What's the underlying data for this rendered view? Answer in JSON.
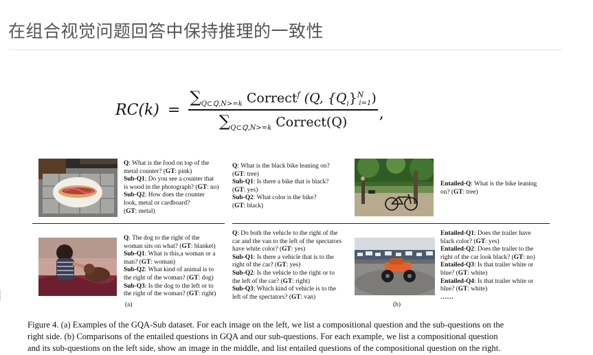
{
  "slide": {
    "title": "在组合视觉问题回答中保持推理的一致性"
  },
  "formula": {
    "lhs": "RC(k)",
    "equals": "=",
    "numerator": "Correct",
    "numerator_sup": "f",
    "denominator": "Correct(Q)",
    "sum_subscript": "Q⊂ℚ,N>=k",
    "args": "(Q, {Q",
    "args_sub": "i",
    "args_close": "}",
    "args_sup": "N",
    "args_sub2": "i=1",
    "args_end": ")",
    "trailing": ","
  },
  "figure": {
    "panel_a": {
      "q1": {
        "lines": [
          [
            "Q",
            ": What is the food on top of the"
          ],
          [
            "",
            "metal counter? ("
          ],
          [
            "Sub-Q1",
            ": Do you see a counter that"
          ],
          [
            "",
            "is wood in the photograph? ("
          ],
          [
            "Sub-Q2",
            ": How does the counter"
          ],
          [
            "",
            "look, metal or cardboard?"
          ],
          [
            "",
            "("
          ]
        ],
        "gt1": "GT",
        "gt1_val": ": pink)",
        "gt2": "GT",
        "gt2_val": ": no)",
        "gt3": "GT",
        "gt3_val": ": metal)"
      },
      "q2": {
        "l1a": "Q",
        "l1b": ": The dog to the right of the",
        "l2a": "woman sits on what? (",
        "l2gt": "GT",
        "l2b": ": blanket)",
        "l3a": "Sub-Q1",
        "l3b": ": What is this,a woman or a",
        "l4a": "man? (",
        "l4gt": "GT",
        "l4b": ": woman)",
        "l5a": "Sub-Q2",
        "l5b": ": What kind of animal is to",
        "l6a": "the right of the woman? (",
        "l6gt": "GT",
        "l6b": ": dog)",
        "l7a": "Sub-Q3",
        "l7b": ": Is the dog to the left or to",
        "l8a": "the right of the woman? (",
        "l8gt": "GT",
        "l8b": ": right)"
      },
      "label": "(a)"
    },
    "panel_b": {
      "top_left": {
        "l1a": "Q",
        "l1b": ": What is the black bike leaning on?",
        "l2a": "(",
        "l2gt": "GT",
        "l2b": ": tree)",
        "l3a": "Sub-Q1",
        "l3b": ": Is there a bike that is black?",
        "l4a": "(",
        "l4gt": "GT",
        "l4b": ": yes)",
        "l5a": "Sub-Q2",
        "l5b": ": What color is the bike?",
        "l6a": "(",
        "l6gt": "GT",
        "l6b": ": black)"
      },
      "top_right": {
        "l1a": "Entailed-Q",
        "l1b": ": What is the bike leaning",
        "l2a": "on? (",
        "l2gt": "GT",
        "l2b": ": tree)"
      },
      "bottom_left": {
        "l1a": "Q",
        "l1b": ": Do both the vehicle to the right of the",
        "l2": "car and the van to the left of the spectators",
        "l3a": "have white color? (",
        "l3gt": "GT",
        "l3b": ": yes)",
        "l4a": "Sub-Q1",
        "l4b": ": Is there a vehicle that is to the",
        "l5a": "right of the car? (",
        "l5gt": "GT",
        "l5b": ": yes)",
        "l6a": "Sub-Q2",
        "l6b": ":  Is the vehicle to the right or to",
        "l7a": "the left of the car? (",
        "l7gt": "GT",
        "l7b": ": right)",
        "l8a": "Sub-Q3",
        "l8b": ": Which kind of vehicle is to the",
        "l9a": "left of the spectators? (",
        "l9gt": "GT",
        "l9b": ": van)"
      },
      "bottom_right": {
        "l1a": "Entailed-Q1",
        "l1b": ": Does the trailer have",
        "l2a": "black color? (",
        "l2gt": "GT",
        "l2b": ": yes)",
        "l3a": "Entailed-Q2",
        "l3b": ": Does the trailer to the",
        "l4a": "right of the car look black? (",
        "l4gt": "GT",
        "l4b": ": no)",
        "l5a": "Entailed-Q3",
        "l5b": ": Is that trailer white or",
        "l6a": "blue? (",
        "l6gt": "GT",
        "l6b": ": white)",
        "l7a": "Entailed-Q4",
        "l7b": ": Is that trailer white or",
        "l8a": "blue? (",
        "l8gt": "GT",
        "l8b": ": white)",
        "l9": "……"
      },
      "label": "(b)"
    },
    "caption": {
      "line1": "Figure 4. (a) Examples of the GQA-Sub dataset. For each image on the left, we list a compositional question and the sub-questions on the",
      "line2": "right side.  (b) Comparisons of the entailed questions in GQA and our sub-questions. For each example, we list a compositional question",
      "line3": "and its sub-questions on the left side, show an image in the middle, and list entailed questions of the compositional question on the right."
    }
  }
}
